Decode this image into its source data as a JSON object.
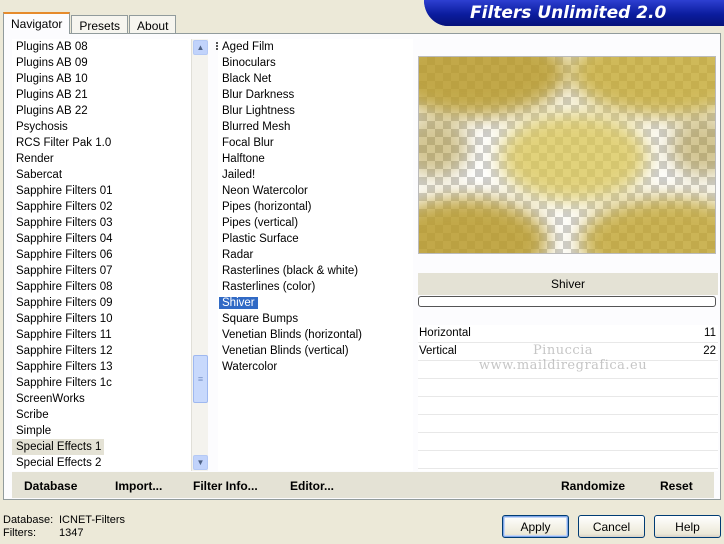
{
  "tabs": [
    "Navigator",
    "Presets",
    "About"
  ],
  "title": "Filters Unlimited 2.0",
  "categories": [
    "Plugins AB 08",
    "Plugins AB 09",
    "Plugins AB 10",
    "Plugins AB 21",
    "Plugins AB 22",
    "Psychosis",
    "RCS Filter Pak 1.0",
    "Render",
    "Sabercat",
    "Sapphire Filters 01",
    "Sapphire Filters 02",
    "Sapphire Filters 03",
    "Sapphire Filters 04",
    "Sapphire Filters 06",
    "Sapphire Filters 07",
    "Sapphire Filters 08",
    "Sapphire Filters 09",
    "Sapphire Filters 10",
    "Sapphire Filters 11",
    "Sapphire Filters 12",
    "Sapphire Filters 13",
    "Sapphire Filters 1c",
    "ScreenWorks",
    "Scribe",
    "Simple",
    "Special Effects 1",
    "Special Effects 2"
  ],
  "selected_category": "Special Effects 1",
  "filters": [
    "Aged Film",
    "Binoculars",
    "Black Net",
    "Blur Darkness",
    "Blur Lightness",
    "Blurred Mesh",
    "Focal Blur",
    "Halftone",
    "Jailed!",
    "Neon Watercolor",
    "Pipes (horizontal)",
    "Pipes (vertical)",
    "Plastic Surface",
    "Radar",
    "Rasterlines (black & white)",
    "Rasterlines (color)",
    "Shiver",
    "Square Bumps",
    "Venetian Blinds (horizontal)",
    "Venetian Blinds (vertical)",
    "Watercolor"
  ],
  "selected_filter": "Shiver",
  "preview": {
    "filter_name": "Shiver",
    "progress": 0
  },
  "params": [
    {
      "label": "Horizontal",
      "value": "11"
    },
    {
      "label": "Vertical",
      "value": "22"
    }
  ],
  "watermark": [
    "Pinuccia",
    "www.maildiregrafica.eu"
  ],
  "bottom_buttons": {
    "database": "Database",
    "import": "Import...",
    "filter_info": "Filter Info...",
    "editor": "Editor...",
    "randomize": "Randomize",
    "reset": "Reset"
  },
  "status": {
    "database_label": "Database:",
    "database_value": "ICNET-Filters",
    "filters_label": "Filters:",
    "filters_value": "1347"
  },
  "dialog_buttons": {
    "apply": "Apply",
    "cancel": "Cancel",
    "help": "Help"
  },
  "colors": {
    "selection": "#316ac5",
    "banner": "#0b1c9e",
    "tab_accent": "#e68b2c",
    "preview_gold": "#c8b040"
  }
}
